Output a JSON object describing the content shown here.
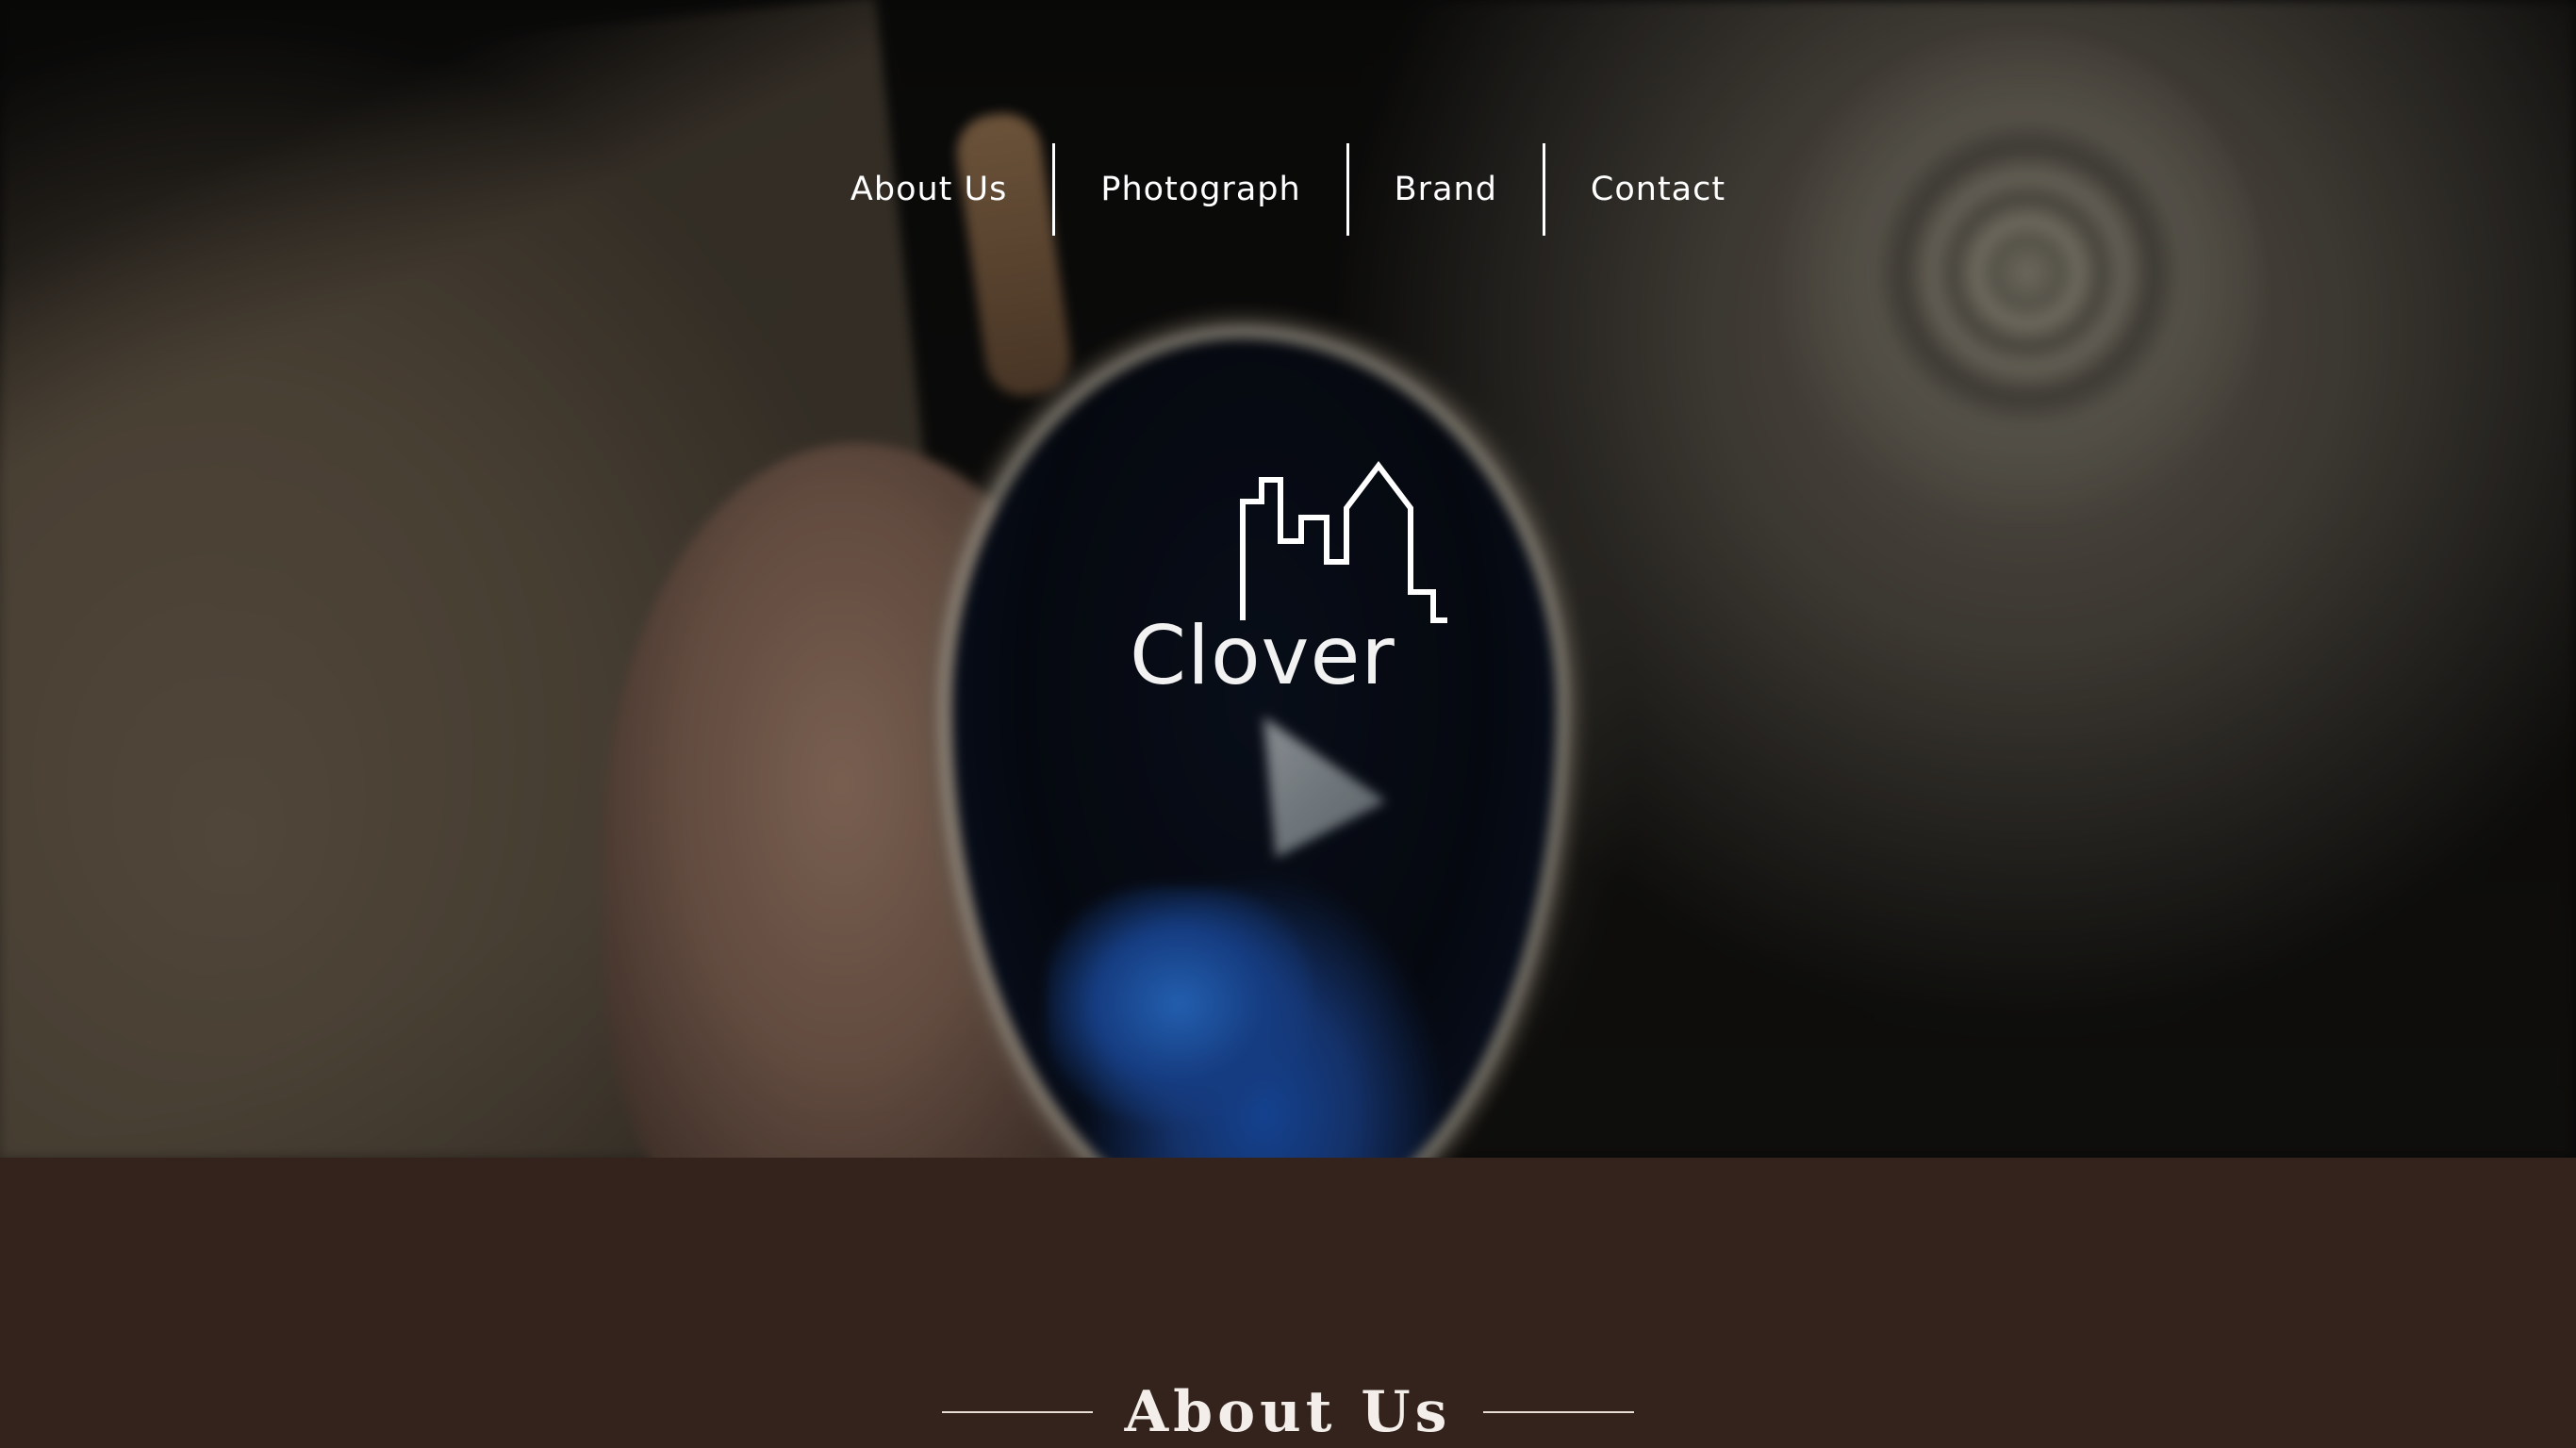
{
  "nav": {
    "items": [
      {
        "label": "About Us"
      },
      {
        "label": "Photograph"
      },
      {
        "label": "Brand"
      },
      {
        "label": "Contact"
      }
    ]
  },
  "logo": {
    "wordmark": "Clover",
    "icon": "city-skyline-icon"
  },
  "about": {
    "heading": "About Us"
  },
  "colors": {
    "section_background": "#33231c",
    "nav_text": "#ffffff",
    "heading_text": "#f3eee9"
  }
}
